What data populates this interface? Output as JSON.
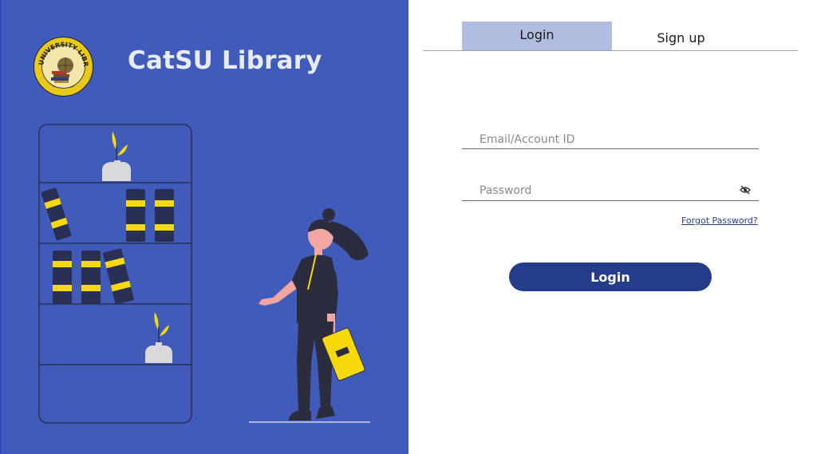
{
  "brand": {
    "name": "CatSU Library",
    "seal_text": "UNIVERSITY LIBRARY"
  },
  "tabs": {
    "login": "Login",
    "signup": "Sign up"
  },
  "form": {
    "email_placeholder": "Email/Account ID",
    "password_placeholder": "Password",
    "forgot_label": "Forgot Password?",
    "submit_label": "Login"
  },
  "icons": {
    "password_toggle": "eye-off-icon",
    "logo": "university-library-seal"
  },
  "colors": {
    "left_bg": "#415bbb",
    "active_tab": "#b1bde0",
    "button": "#243c8a",
    "accent_yellow": "#f5d90a"
  }
}
